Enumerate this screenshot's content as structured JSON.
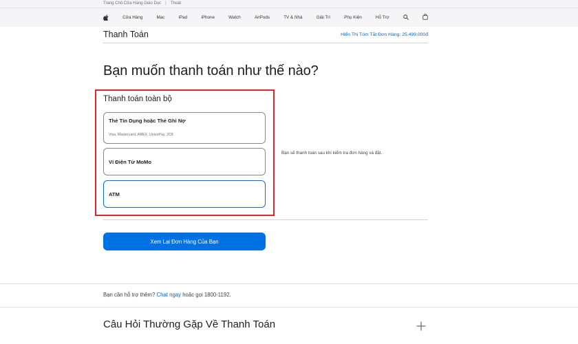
{
  "topbar": {
    "store_link": "Trang Chủ Cửa Hàng Giáo Dục",
    "separator": "|",
    "logout_link": "Thoát"
  },
  "globalnav": {
    "items": [
      {
        "label": "Cửa Hàng"
      },
      {
        "label": "Mac"
      },
      {
        "label": "iPad"
      },
      {
        "label": "iPhone"
      },
      {
        "label": "Watch"
      },
      {
        "label": "AirPods"
      },
      {
        "label": "TV & Nhà"
      },
      {
        "label": "Giải Trí"
      },
      {
        "label": "Phụ Kiện"
      },
      {
        "label": "Hỗ Trợ"
      }
    ],
    "icons": [
      "apple-logo-icon",
      "search-icon",
      "shopping-bag-icon"
    ]
  },
  "subheader": {
    "title": "Thanh Toán",
    "order_summary": "Hiển Thị Tóm Tắt Đơn Hàng: 25.499.000đ"
  },
  "main": {
    "heading": "Bạn muốn thanh toán như thế nào?",
    "section_title": "Thanh toán toàn bộ",
    "options": [
      {
        "title": "Thẻ Tín Dụng hoặc Thẻ Ghi Nợ",
        "subtitle": "Visa, Mastercard, AMEX, UnionPay, JCB"
      },
      {
        "title": "Ví Điện Tử MoMo"
      },
      {
        "title": "ATM"
      }
    ],
    "side_note": "Bạn sẽ thanh toán sau khi kiểm tra đơn hàng và đặt.",
    "review_button": "Xem Lại Đơn Hàng Của Bạn"
  },
  "help": {
    "prefix": "Bạn cần hỗ trợ thêm?",
    "chat_link": "Chat ngay",
    "suffix": "hoặc gọi 1800-1192."
  },
  "faq": {
    "title": "Câu Hỏi Thường Gặp Về Thanh Toán",
    "toggle_symbol": "+"
  },
  "colors": {
    "accent": "#0071e3",
    "link": "#0066cc",
    "highlight": "#e0242b"
  }
}
